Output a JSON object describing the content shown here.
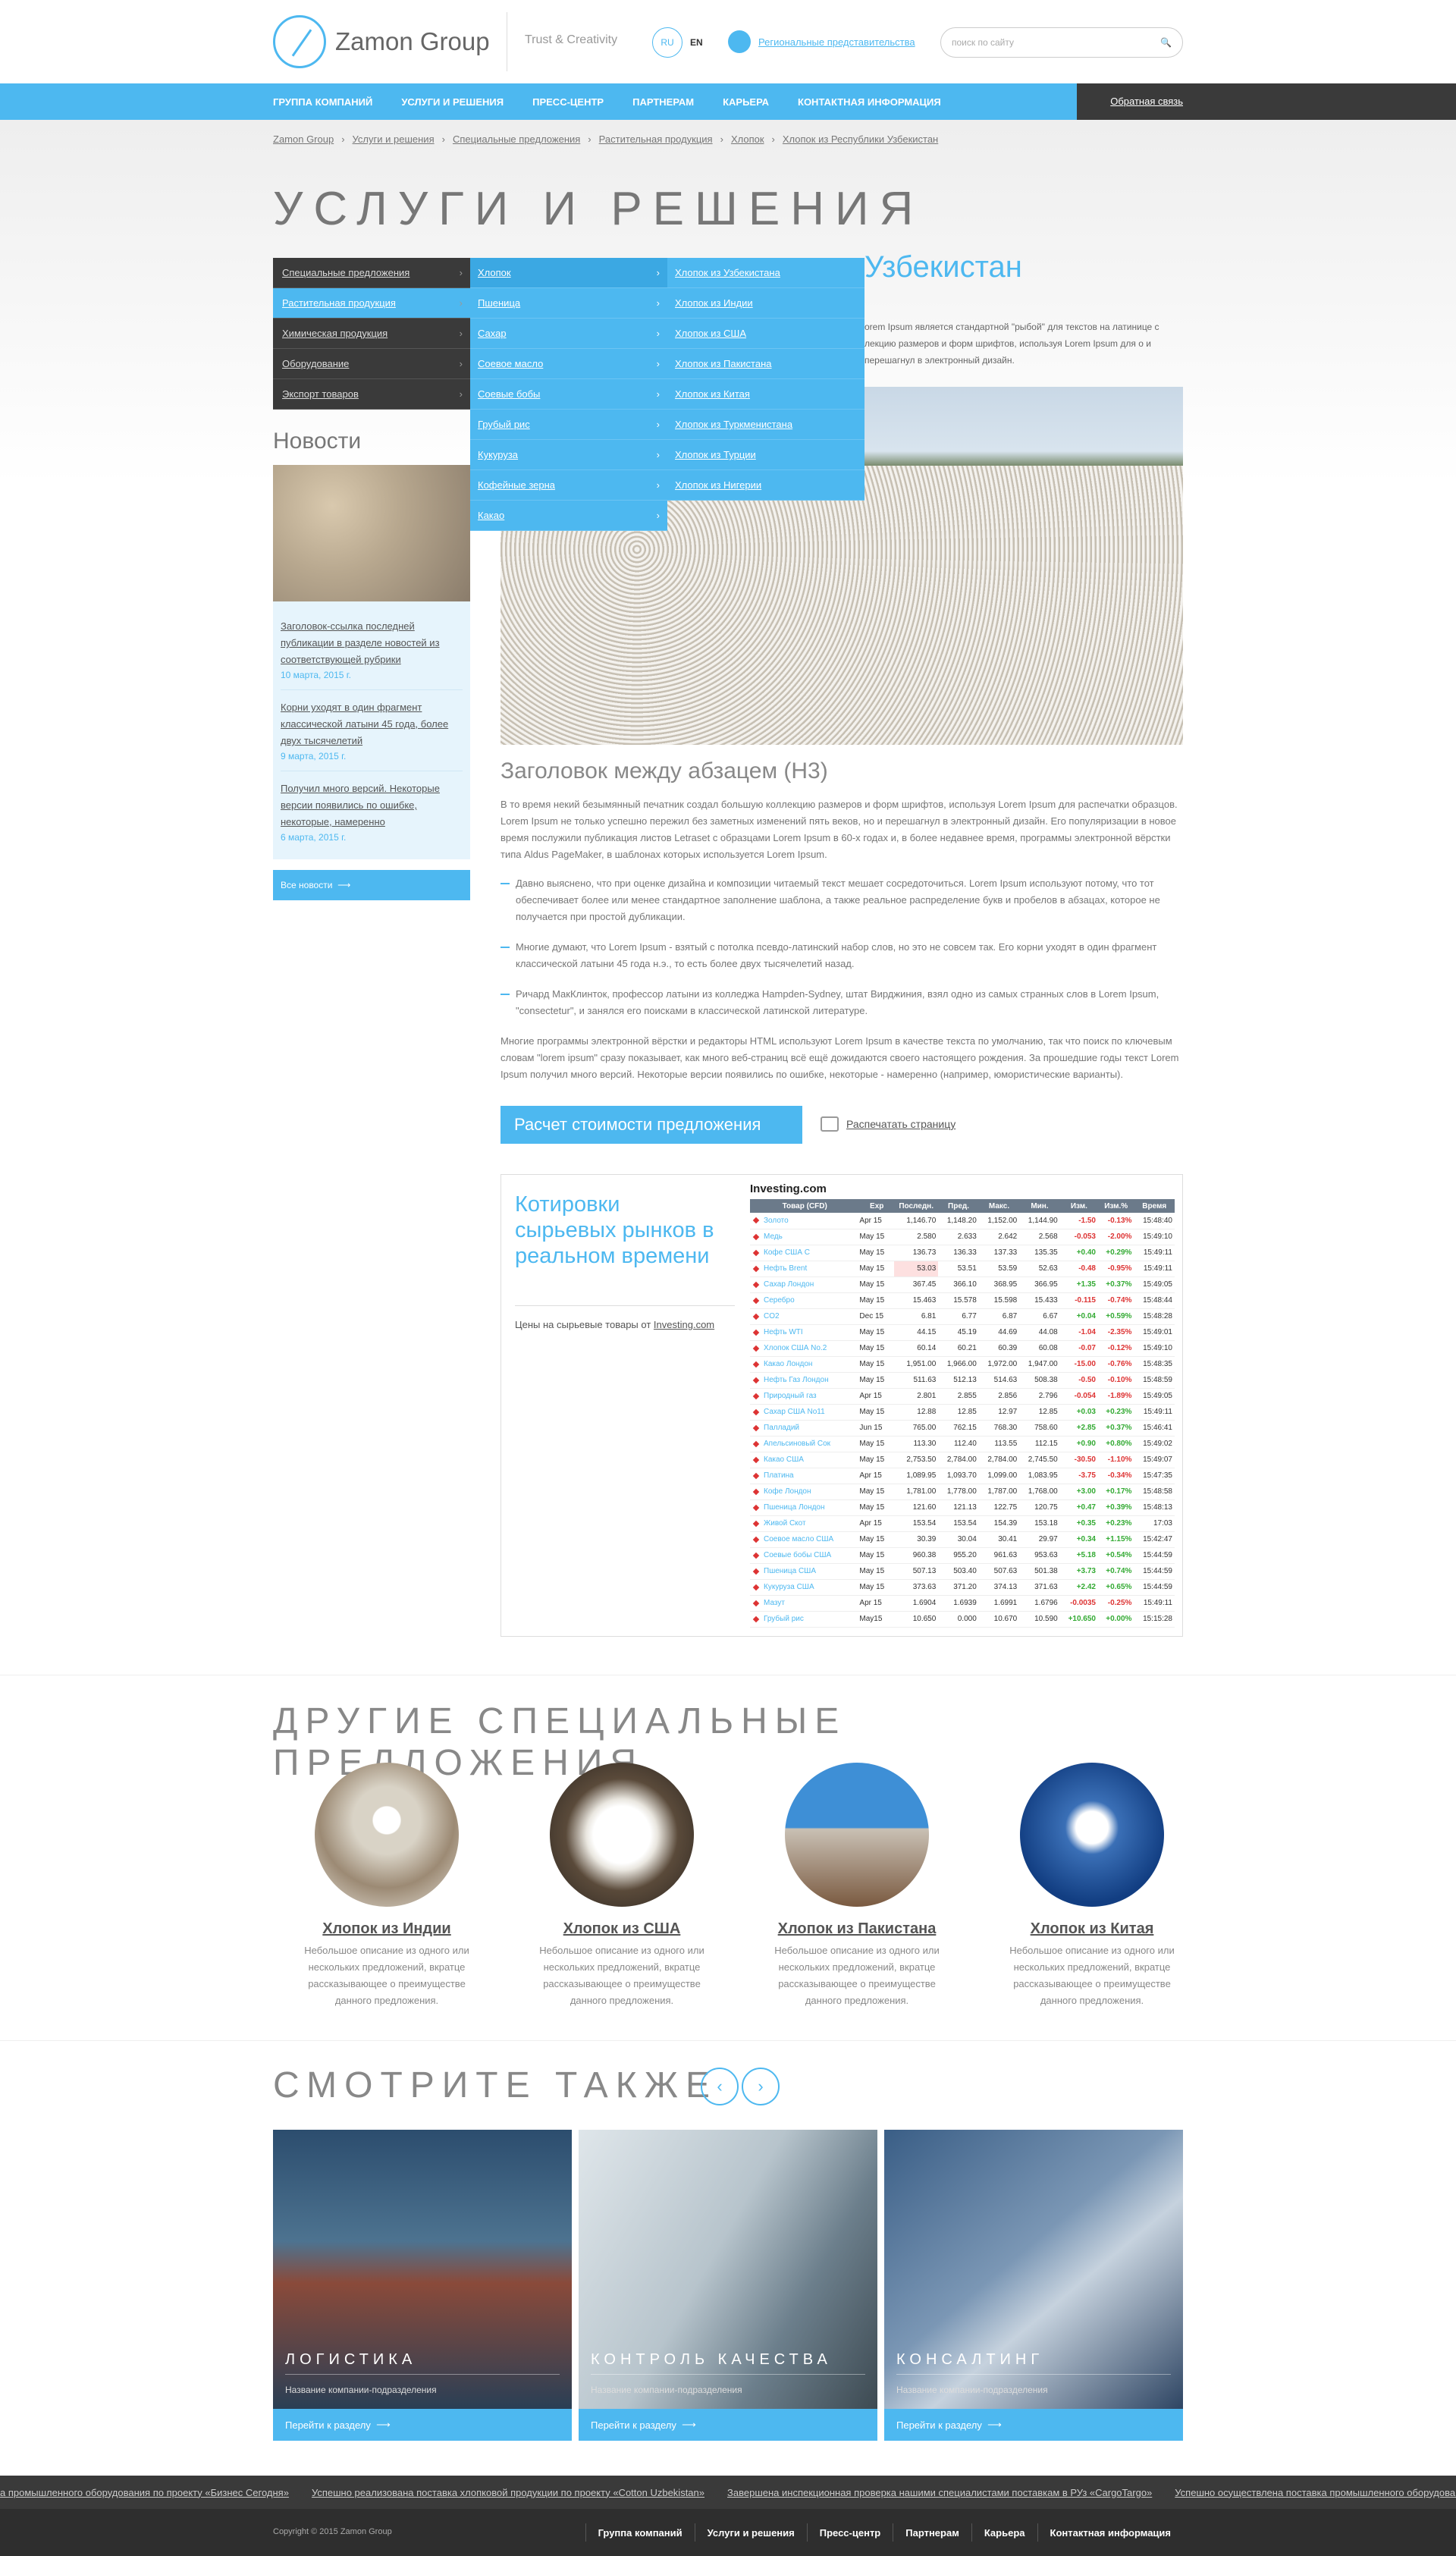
{
  "header": {
    "logo_text": "Zamon Group",
    "tagline": "Trust & Creativity",
    "lang_ru": "RU",
    "lang_en": "EN",
    "regional": "Региональные представительства",
    "search_placeholder": "поиск по сайту"
  },
  "nav": {
    "items": [
      "Группа компаний",
      "Услуги и решения",
      "Пресс-центр",
      "Партнерам",
      "Карьера",
      "Контактная информация"
    ],
    "feedback": "Обратная связь"
  },
  "breadcrumb": [
    "Zamon Group",
    "Услуги и решения",
    "Специальные предложения",
    "Растительная продукция",
    "Хлопок",
    "Хлопок из Республики Узбекистан"
  ],
  "page_title": "УСЛУГИ И РЕШЕНИЯ",
  "side_menu": [
    "Специальные предложения",
    "Растительная продукция",
    "Химическая продукция",
    "Оборудование",
    "Экспорт товаров"
  ],
  "sub_menu1": [
    "Хлопок",
    "Пшеница",
    "Сахар",
    "Соевое масло",
    "Соевые бобы",
    "Грубый рис",
    "Кукуруза",
    "Кофейные зерна",
    "Какао"
  ],
  "sub_menu2": [
    "Хлопок из Узбекистана",
    "Хлопок из Индии",
    "Хлопок из США",
    "Хлопок из Пакистана",
    "Хлопок из Китая",
    "Хлопок из Туркменистана",
    "Хлопок из Турции",
    "Хлопок из Нигерии"
  ],
  "main_title": "Узбекистан",
  "intro": "orem Ipsum является стандартной \"рыбой\" для текстов на латинице с лекцию размеров и форм шрифтов, используя Lorem Ipsum для о и перешагнул в электронный дизайн.",
  "news": {
    "title": "Новости",
    "items": [
      {
        "link": "Заголовок-ссылка последней публикации в разделе новостей из соответствующей рубрики",
        "date": "10 марта, 2015 г."
      },
      {
        "link": "Корни уходят в один фрагмент классической латыни 45 года, более двух тысячелетий",
        "date": "9 марта, 2015 г."
      },
      {
        "link": "Получил много версий. Некоторые версии появились по ошибке, некоторые, намеренно",
        "date": "6 марта, 2015 г."
      }
    ],
    "all": "Все новости"
  },
  "content": {
    "h3": "Заголовок между абзацем (H3)",
    "p1": "В то время некий безымянный печатник создал большую коллекцию размеров и форм шрифтов, используя Lorem Ipsum для распечатки образцов. Lorem Ipsum не только успешно пережил без заметных изменений пять веков, но и перешагнул в электронный дизайн. Его популяризации в новое время послужили публикация листов Letraset с образцами Lorem Ipsum в 60-х годах и, в более недавнее время, программы электронной вёрстки типа Aldus PageMaker, в шаблонах которых используется Lorem Ipsum.",
    "b1": "Давно выяснено, что при оценке дизайна и композиции читаемый текст мешает сосредоточиться. Lorem Ipsum используют потому, что тот обеспечивает более или менее стандартное заполнение шаблона, а также реальное распределение букв и пробелов в абзацах, которое не получается при простой дубликации.",
    "b2": "Многие думают, что Lorem Ipsum - взятый с потолка псевдо-латинский набор слов, но это не совсем так. Его корни уходят в один фрагмент классической латыни 45 года н.э., то есть более двух тысячелетий назад.",
    "b3": "Ричард МакКлинток, профессор латыни из колледжа Hampden-Sydney, штат Вирджиния, взял одно из самых странных слов в Lorem Ipsum, \"consectetur\", и занялся его поисками в классической латинской литературе.",
    "p2": "Многие программы электронной вёрстки и редакторы HTML используют Lorem Ipsum в качестве текста по умолчанию, так что поиск по ключевым словам \"lorem ipsum\" сразу показывает, как много веб-страниц всё ещё дожидаются своего настоящего рождения. За прошедшие годы текст Lorem Ipsum получил много версий. Некоторые версии появились по ошибке, некоторые - намеренно (например, юмористические варианты).",
    "calc": "Расчет стоимости предложения",
    "print": "Распечатать страницу"
  },
  "quotes": {
    "title": "Котировки сырьевых рынков в реальном времени",
    "sub_prefix": "Цены на сырьевые товары от",
    "sub_link": "Investing.com",
    "logo": "Investing.com",
    "headers": [
      "Товар (CFD)",
      "Exp",
      "Последн.",
      "Пред.",
      "Макс.",
      "Мин.",
      "Изм.",
      "Изм.%",
      "Время"
    ],
    "rows": [
      [
        "Золото",
        "Apr 15",
        "1,146.70",
        "1,148.20",
        "1,152.00",
        "1,144.90",
        "-1.50",
        "-0.13%",
        "15:48:40"
      ],
      [
        "Медь",
        "May 15",
        "2.580",
        "2.633",
        "2.642",
        "2.568",
        "-0.053",
        "-2.00%",
        "15:49:10"
      ],
      [
        "Кофе США С",
        "May 15",
        "136.73",
        "136.33",
        "137.33",
        "135.35",
        "+0.40",
        "+0.29%",
        "15:49:11"
      ],
      [
        "Нефть Brent",
        "May 15",
        "53.03",
        "53.51",
        "53.59",
        "52.63",
        "-0.48",
        "-0.95%",
        "15:49:11"
      ],
      [
        "Сахар Лондон",
        "May 15",
        "367.45",
        "366.10",
        "368.95",
        "366.95",
        "+1.35",
        "+0.37%",
        "15:49:05"
      ],
      [
        "Серебро",
        "May 15",
        "15.463",
        "15.578",
        "15.598",
        "15.433",
        "-0.115",
        "-0.74%",
        "15:48:44"
      ],
      [
        "CO2",
        "Dec 15",
        "6.81",
        "6.77",
        "6.87",
        "6.67",
        "+0.04",
        "+0.59%",
        "15:48:28"
      ],
      [
        "Нефть WTI",
        "May 15",
        "44.15",
        "45.19",
        "44.69",
        "44.08",
        "-1.04",
        "-2.35%",
        "15:49:01"
      ],
      [
        "Хлопок США No.2",
        "May 15",
        "60.14",
        "60.21",
        "60.39",
        "60.08",
        "-0.07",
        "-0.12%",
        "15:49:10"
      ],
      [
        "Какао Лондон",
        "May 15",
        "1,951.00",
        "1,966.00",
        "1,972.00",
        "1,947.00",
        "-15.00",
        "-0.76%",
        "15:48:35"
      ],
      [
        "Нефть Газ Лондон",
        "May 15",
        "511.63",
        "512.13",
        "514.63",
        "508.38",
        "-0.50",
        "-0.10%",
        "15:48:59"
      ],
      [
        "Природный газ",
        "Apr 15",
        "2.801",
        "2.855",
        "2.856",
        "2.796",
        "-0.054",
        "-1.89%",
        "15:49:05"
      ],
      [
        "Сахар США No11",
        "May 15",
        "12.88",
        "12.85",
        "12.97",
        "12.85",
        "+0.03",
        "+0.23%",
        "15:49:11"
      ],
      [
        "Палладий",
        "Jun 15",
        "765.00",
        "762.15",
        "768.30",
        "758.60",
        "+2.85",
        "+0.37%",
        "15:46:41"
      ],
      [
        "Апельсиновый Сок",
        "May 15",
        "113.30",
        "112.40",
        "113.55",
        "112.15",
        "+0.90",
        "+0.80%",
        "15:49:02"
      ],
      [
        "Какао США",
        "May 15",
        "2,753.50",
        "2,784.00",
        "2,784.00",
        "2,745.50",
        "-30.50",
        "-1.10%",
        "15:49:07"
      ],
      [
        "Платина",
        "Apr 15",
        "1,089.95",
        "1,093.70",
        "1,099.00",
        "1,083.95",
        "-3.75",
        "-0.34%",
        "15:47:35"
      ],
      [
        "Кофе Лондон",
        "May 15",
        "1,781.00",
        "1,778.00",
        "1,787.00",
        "1,768.00",
        "+3.00",
        "+0.17%",
        "15:48:58"
      ],
      [
        "Пшеница Лондон",
        "May 15",
        "121.60",
        "121.13",
        "122.75",
        "120.75",
        "+0.47",
        "+0.39%",
        "15:48:13"
      ],
      [
        "Живой Скот",
        "Apr 15",
        "153.54",
        "153.54",
        "154.39",
        "153.18",
        "+0.35",
        "+0.23%",
        "17:03"
      ],
      [
        "Соевое масло США",
        "May 15",
        "30.39",
        "30.04",
        "30.41",
        "29.97",
        "+0.34",
        "+1.15%",
        "15:42:47"
      ],
      [
        "Соевые бобы США",
        "May 15",
        "960.38",
        "955.20",
        "961.63",
        "953.63",
        "+5.18",
        "+0.54%",
        "15:44:59"
      ],
      [
        "Пшеница США",
        "May 15",
        "507.13",
        "503.40",
        "507.63",
        "501.38",
        "+3.73",
        "+0.74%",
        "15:44:59"
      ],
      [
        "Кукуруза США",
        "May 15",
        "373.63",
        "371.20",
        "374.13",
        "371.63",
        "+2.42",
        "+0.65%",
        "15:44:59"
      ],
      [
        "Мазут",
        "Apr 15",
        "1.6904",
        "1.6939",
        "1.6991",
        "1.6796",
        "-0.0035",
        "-0.25%",
        "15:49:11"
      ],
      [
        "Грубый рис",
        "May15",
        "10.650",
        "0.000",
        "10.670",
        "10.590",
        "+10.650",
        "+0.00%",
        "15:15:28"
      ]
    ]
  },
  "offers": {
    "title": "ДРУГИЕ СПЕЦИАЛЬНЫЕ ПРЕДЛОЖЕНИЯ",
    "items": [
      {
        "name": "Хлопок из Индии",
        "desc": "Небольшое описание из одного или нескольких предложений, вкратце рассказывающее о преимуществе данного предложения."
      },
      {
        "name": "Хлопок из США",
        "desc": "Небольшое описание из одного или нескольких предложений, вкратце рассказывающее о преимуществе данного предложения."
      },
      {
        "name": "Хлопок из Пакистана",
        "desc": "Небольшое описание из одного или нескольких предложений, вкратце рассказывающее о преимуществе данного предложения."
      },
      {
        "name": "Хлопок из Китая",
        "desc": "Небольшое описание из одного или нескольких предложений, вкратце рассказывающее о преимуществе данного предложения."
      }
    ]
  },
  "see_also": {
    "title": "СМОТРИТЕ ТАКЖЕ",
    "items": [
      {
        "title": "Логистика",
        "sub": "Название компании-подразделения",
        "link": "Перейти к разделу"
      },
      {
        "title": "Контроль качества",
        "sub": "Название компании-подразделения",
        "link": "Перейти к разделу"
      },
      {
        "title": "Консалтинг",
        "sub": "Название компании-подразделения",
        "link": "Перейти к разделу"
      }
    ]
  },
  "ticker": [
    "а промышленного оборудования по проекту «Бизнес Сегодня»",
    "Успешно реализована поставка хлопковой продукции по проекту «Cotton Uzbekistan»",
    "Завершена инспекционная проверка нашими специалистами поставкам в РУз «CargoTargo»",
    "Успешно осуществлена поставка промышленного оборудования"
  ],
  "footer": {
    "copyright": "Copyright © 2015 Zamon Group",
    "nav": [
      "Группа компаний",
      "Услуги и решения",
      "Пресс-центр",
      "Партнерам",
      "Карьера",
      "Контактная информация"
    ]
  }
}
